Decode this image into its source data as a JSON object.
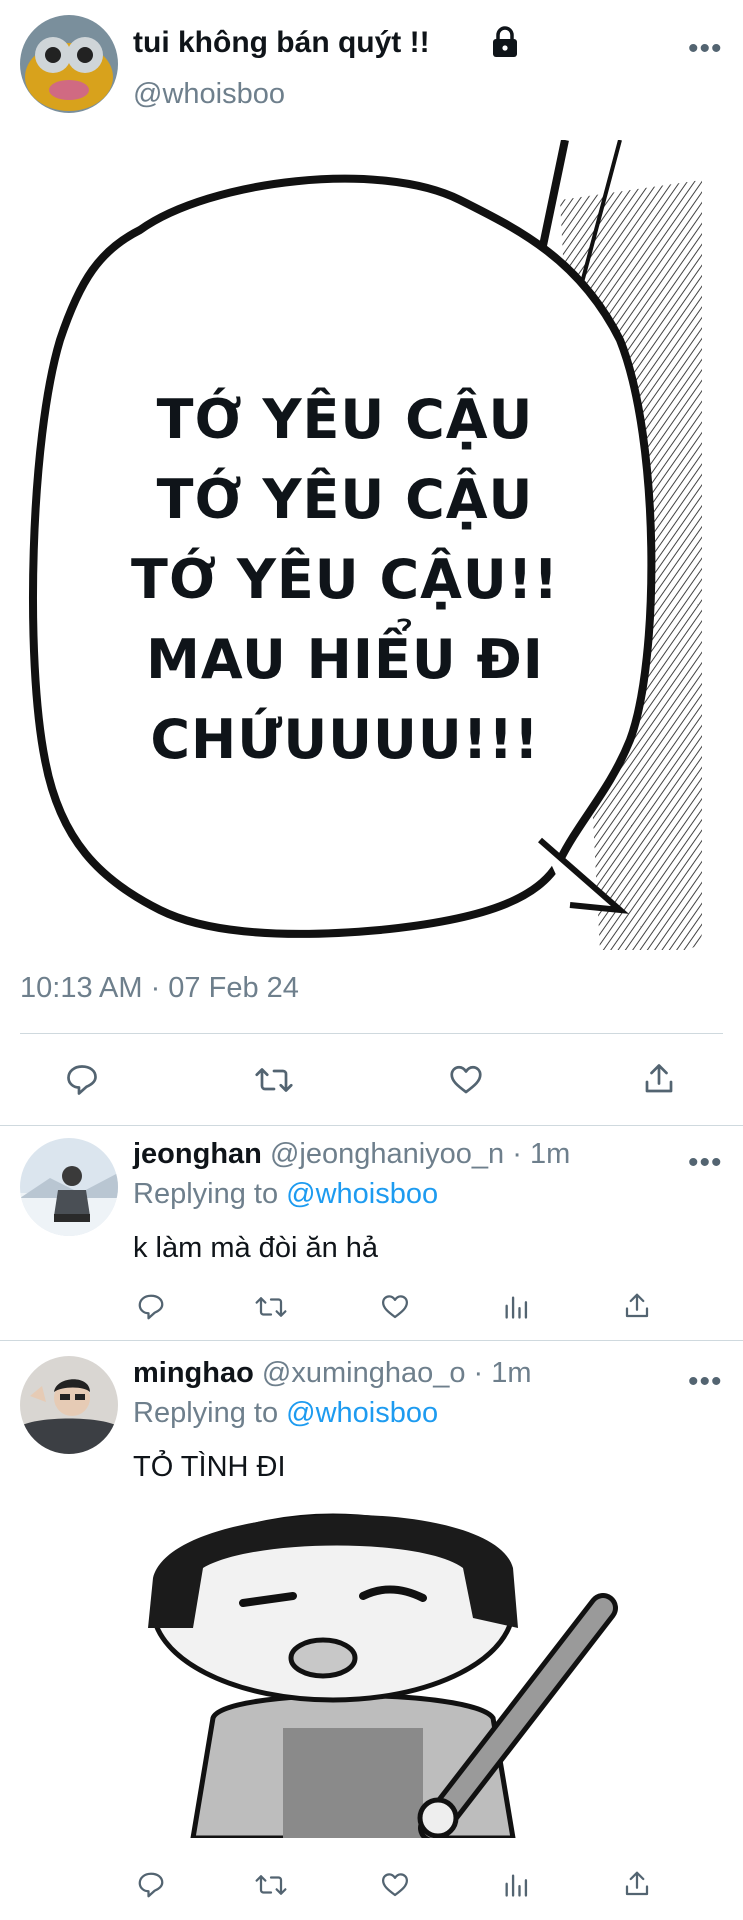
{
  "main_tweet": {
    "display_name": "tui không bán quýt !!",
    "handle": "@whoisboo",
    "more_icon": "more-horizontal-icon",
    "image_text": [
      "TỚ YÊU CẬU",
      "TỚ YÊU CẬU",
      "TỚ YÊU CẬU!!",
      "MAU HIỂU ĐI",
      "CHỨUUUU!!!"
    ],
    "timestamp": "10:13 AM · 07 Feb 24",
    "actions": [
      "reply-icon",
      "retweet-icon",
      "like-icon",
      "share-icon"
    ]
  },
  "replies": [
    {
      "name": "jeonghan",
      "handle": "@jeonghaniyoo_n",
      "time": "· 1m",
      "replying_prefix": "Replying to",
      "replying_to": "@whoisboo",
      "text": "k làm mà đòi ăn hả"
    },
    {
      "name": "minghao",
      "handle": "@xuminghao_o",
      "time": "· 1m",
      "replying_prefix": "Replying to",
      "replying_to": "@whoisboo",
      "text": "TỎ TÌNH ĐI"
    }
  ],
  "colors": {
    "link": "#1d9bf0",
    "muted": "#6e7f8c",
    "divider": "#cfd9de",
    "text": "#0f1419"
  }
}
